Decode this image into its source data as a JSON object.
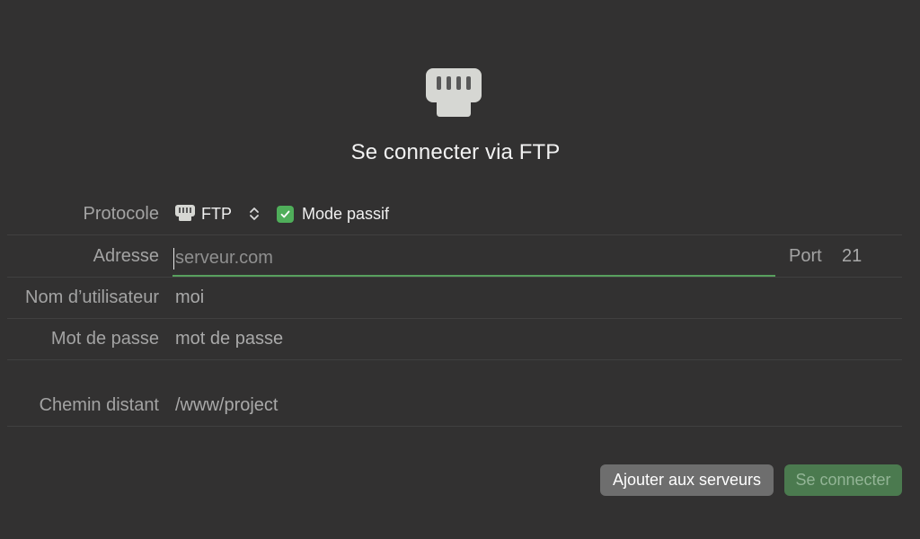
{
  "dialog": {
    "icon": "ethernet-port-icon",
    "title": "Se connecter via FTP"
  },
  "protocol": {
    "label": "Protocole",
    "value": "FTP",
    "icon": "ethernet-port-icon",
    "passive_mode": {
      "label": "Mode passif",
      "checked": true
    }
  },
  "address": {
    "label": "Adresse",
    "placeholder": "serveur.com",
    "value": ""
  },
  "port": {
    "label": "Port",
    "value": "21"
  },
  "username": {
    "label": "Nom d’utilisateur",
    "value": "moi"
  },
  "password": {
    "label": "Mot de passe",
    "value": "mot de passe"
  },
  "remote_path": {
    "label": "Chemin distant",
    "value": "/www/project"
  },
  "buttons": {
    "add_to_servers": "Ajouter aux serveurs",
    "connect": "Se connecter"
  },
  "colors": {
    "background": "#323131",
    "accent_green": "#4fae5a",
    "connect_button": "#4b7a4f",
    "secondary_button": "#6e6e6e"
  }
}
